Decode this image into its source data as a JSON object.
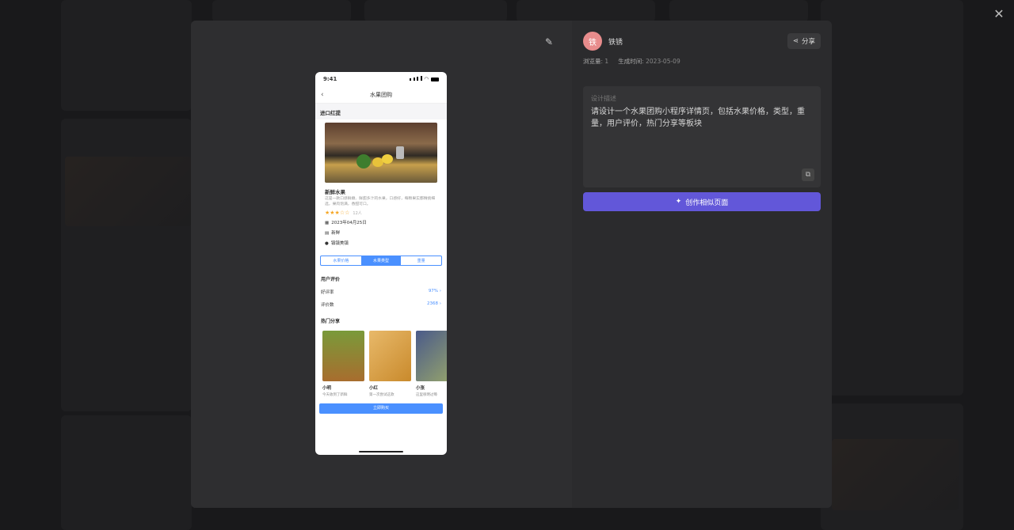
{
  "background_accent": "#222224",
  "modal": {
    "close_icon": "close-icon",
    "edit_icon": "pencil-icon"
  },
  "phone": {
    "status_time": "9:41",
    "nav_title": "水果团购",
    "section_title": "进口红提",
    "product_name": "新鲜水果",
    "product_desc": "这是一款口感鲜嫩、鲜甜多汁的水果，口感好，每颗果实都精挑细选，果肉饱满，香甜可口。",
    "rating_text": "12人",
    "meta": [
      {
        "icon": "calendar-icon",
        "text": "2023年04月25日"
      },
      {
        "icon": "document-icon",
        "text": "新鲜"
      },
      {
        "icon": "location-icon",
        "text": "镇镇美镇"
      }
    ],
    "segments": [
      "水果价格",
      "水果类型",
      "重量"
    ],
    "active_segment": 1,
    "review_title": "用户评价",
    "rows": [
      {
        "label": "好评率",
        "value": "97%"
      },
      {
        "label": "评价数",
        "value": "2368"
      }
    ],
    "share_title": "热门分享",
    "cards": [
      {
        "name": "小明",
        "text": "今天收到了新鲜"
      },
      {
        "name": "小红",
        "text": "第一次尝试这款"
      },
      {
        "name": "小张",
        "text": "这里很明过莓"
      }
    ],
    "buy_button": "立即购买"
  },
  "info": {
    "avatar_char": "铁",
    "username": "铁锈",
    "share_label": "分享",
    "views_label": "浏览量",
    "views_value": "1",
    "created_label": "生成时间",
    "created_value": "2023-05-09",
    "desc_label": "设计描述",
    "desc_text": "请设计一个水果团购小程序详情页，包括水果价格，类型，重量，用户评价，热门分享等板块",
    "create_button": "创作相似页面"
  },
  "colors": {
    "accent": "#6257d9",
    "phone_blue": "#4a90ff",
    "avatar": "#e88c8c"
  }
}
